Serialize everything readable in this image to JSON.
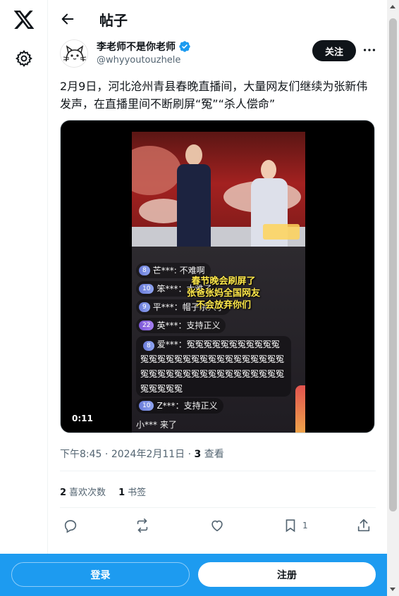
{
  "nav": {
    "logo_icon": "x-logo-icon",
    "settings_icon": "gear-icon"
  },
  "header": {
    "back_icon": "arrow-left-icon",
    "title": "帖子"
  },
  "author": {
    "name": "李老师不是你老师",
    "handle": "@whyyoutouzhele",
    "verified": true,
    "follow_label": "关注",
    "more_icon": "more-horizontal-icon"
  },
  "post": {
    "text": "2月9日，河北沧州青县春晚直播间，大量网友们继续为张新伟发声，在直播里间不断刷屏“冤”“杀人偿命”",
    "media": {
      "type": "video",
      "duration": "0:11",
      "caption_lines": [
        "春节晚会刷屏了",
        "张爸张妈全国网友",
        "不会放弃你们"
      ],
      "chat": [
        {
          "badge": "8",
          "text": "芒***: 不难啊"
        },
        {
          "badge": "10",
          "text": "笨***：太难了"
        },
        {
          "badge": "9",
          "text": "平***：帽子杀人了"
        },
        {
          "badge": "22",
          "text": "英***：支持正义"
        },
        {
          "badge": "8",
          "text": "爱***：冤冤冤冤冤冤冤冤冤冤冤冤冤冤冤冤冤冤冤冤冤冤冤冤冤冤冤冤冤冤冤冤冤冤冤冤冤冤冤冤冤冤冤冤冤冤冤冤冤冤"
        },
        {
          "badge": "10",
          "text": "Z***：支持正义"
        },
        {
          "badge": "",
          "text": "小*** 来了"
        }
      ]
    },
    "time": "下午8:45",
    "date": "2024年2月11日",
    "views_count": "3",
    "views_label": "查看",
    "likes_count": "2",
    "likes_label": "喜欢次数",
    "bookmarks_count": "1",
    "bookmarks_label": "书签"
  },
  "actions": {
    "reply_icon": "reply-icon",
    "repost_icon": "repost-icon",
    "like_icon": "heart-icon",
    "bookmark_icon": "bookmark-icon",
    "bookmark_count": "1",
    "share_icon": "share-icon"
  },
  "bottom_bar": {
    "login_label": "登录",
    "signup_label": "注册"
  },
  "colors": {
    "brand": "#1d9bf0",
    "text": "#0f1419",
    "muted": "#536471"
  }
}
